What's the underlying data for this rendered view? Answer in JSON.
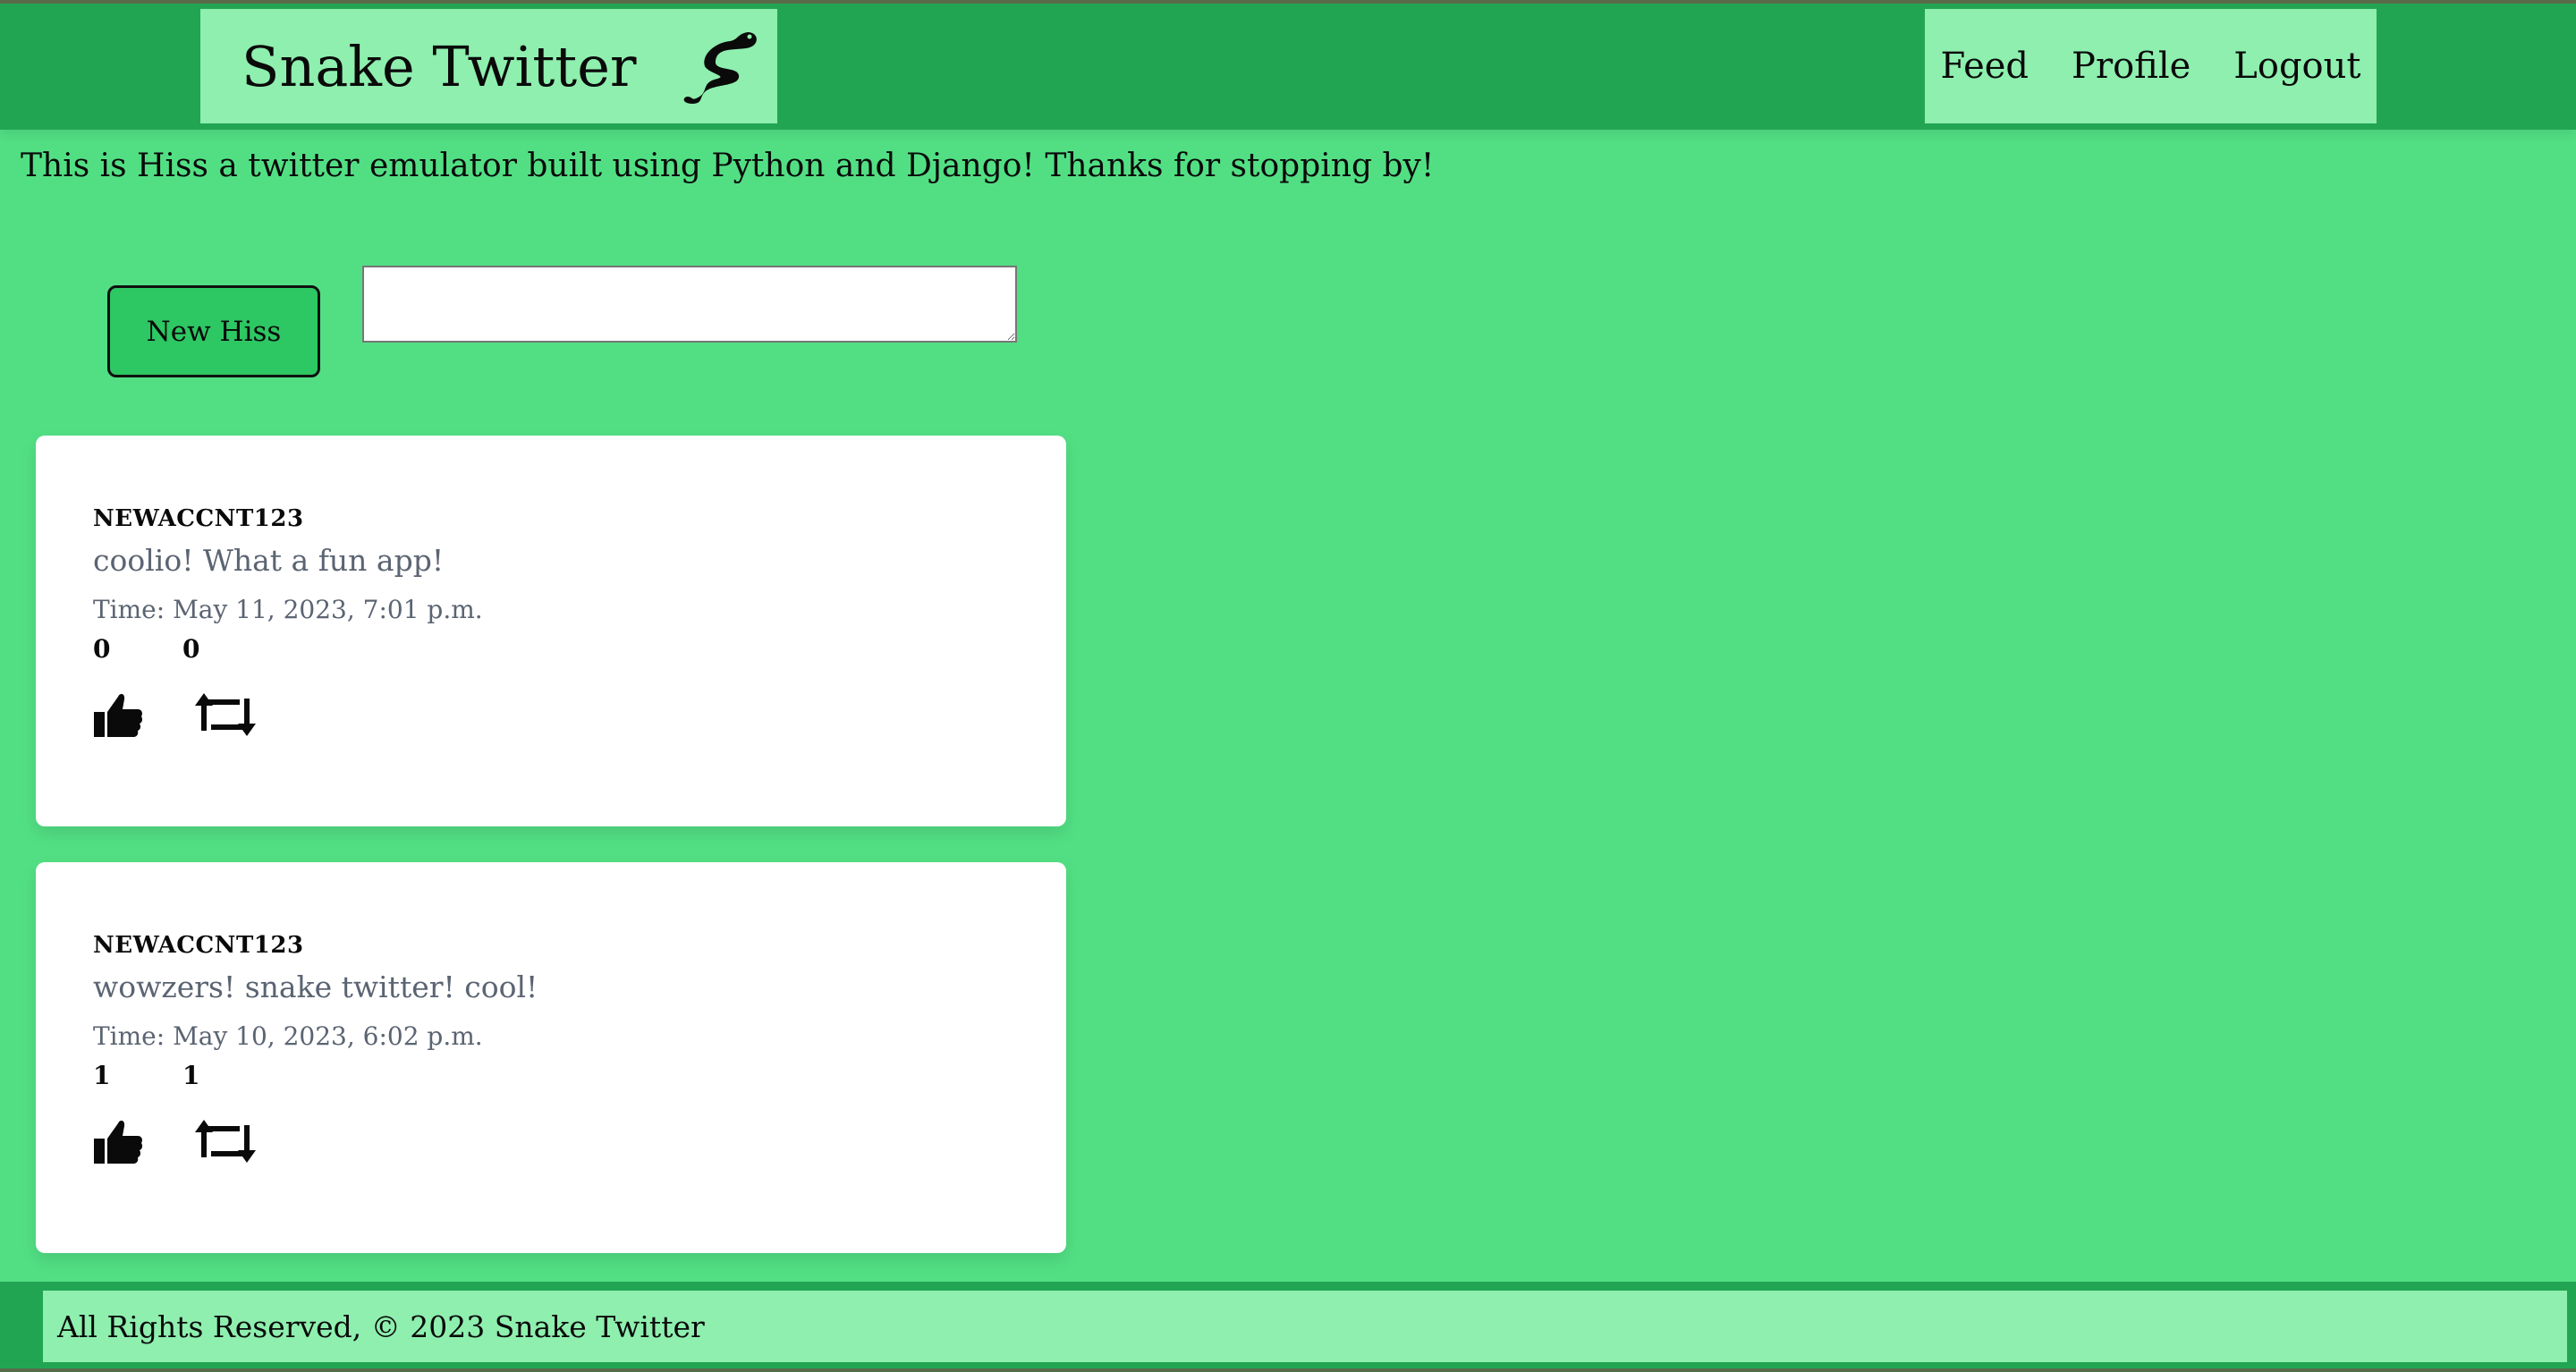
{
  "header": {
    "brand_title": "Snake Twitter",
    "brand_icon": "snake-icon",
    "nav": [
      {
        "label": "Feed"
      },
      {
        "label": "Profile"
      },
      {
        "label": "Logout"
      }
    ]
  },
  "intro_text": "This is Hiss a twitter emulator built using Python and Django! Thanks for stopping by!",
  "composer": {
    "button_label": "New Hiss",
    "input_value": ""
  },
  "posts": [
    {
      "author": "NEWACCNT123",
      "content": "coolio! What a fun app!",
      "time": "Time: May 11, 2023, 7:01 p.m.",
      "likes": "0",
      "rehisses": "0",
      "like_icon": "thumbs-up-icon",
      "rehiss_icon": "retweet-icon"
    },
    {
      "author": "NEWACCNT123",
      "content": "wowzers! snake twitter! cool!",
      "time": "Time: May 10, 2023, 6:02 p.m.",
      "likes": "1",
      "rehisses": "1",
      "like_icon": "thumbs-up-icon",
      "rehiss_icon": "retweet-icon"
    }
  ],
  "footer": {
    "text": "All Rights Reserved, © 2023 Snake Twitter"
  },
  "colors": {
    "page_bg": "#52df84",
    "header_bg": "#22a553",
    "panel_bg": "#8eefae",
    "button_bg": "#2dc763",
    "muted_text": "#5b6472"
  }
}
